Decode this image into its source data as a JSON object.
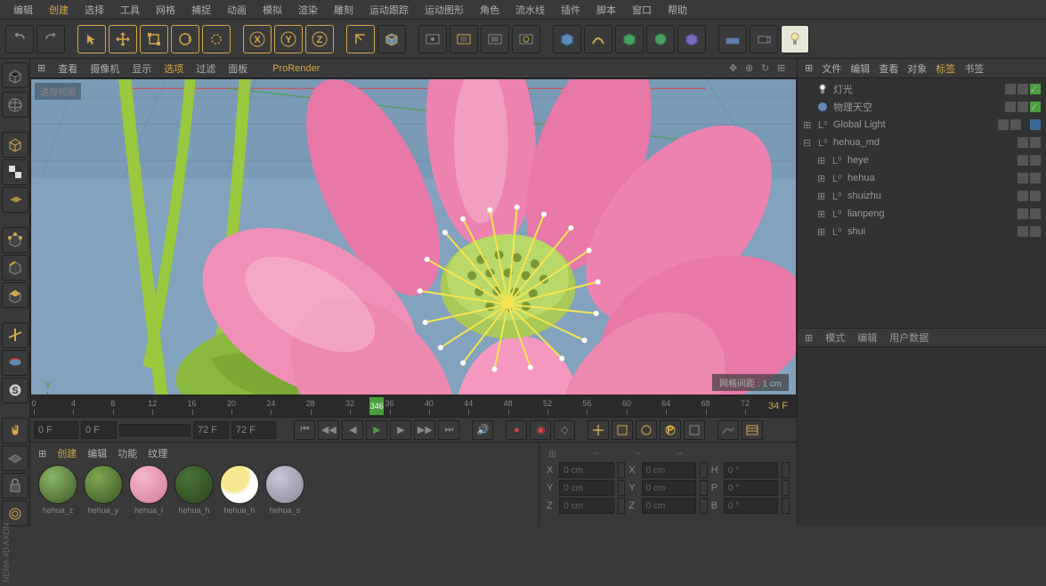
{
  "menubar": [
    "编辑",
    "创建",
    "选择",
    "工具",
    "网格",
    "捕捉",
    "动画",
    "模拟",
    "渲染",
    "雕刻",
    "运动跟踪",
    "运动图形",
    "角色",
    "流水线",
    "插件",
    "脚本",
    "窗口",
    "帮助"
  ],
  "menubar_active": [
    1
  ],
  "viewport_menu": {
    "icon": "⊞",
    "items": [
      "查看",
      "摄像机",
      "显示",
      "选项",
      "过滤",
      "面板"
    ],
    "prorender": "ProRender",
    "active_idx": 3
  },
  "viewport_label": "透视视图",
  "grid_info": "网格间距 : 1 cm",
  "axis": {
    "x": "X",
    "y": "Y",
    "z": "Z"
  },
  "timeline": {
    "ticks": [
      0,
      4,
      8,
      12,
      16,
      20,
      24,
      28,
      32,
      36,
      40,
      44,
      48,
      52,
      56,
      60,
      64,
      68,
      72
    ],
    "playhead": 34,
    "playhead_label": "346",
    "frame_display": "34 F"
  },
  "playback": {
    "start": "0 F",
    "slider_end": "0 F",
    "end": "72 F",
    "end2": "72 F"
  },
  "materials_menu": {
    "items": [
      "创建",
      "编辑",
      "功能",
      "纹理"
    ],
    "active_idx": 0
  },
  "materials": [
    {
      "name": "hehua_z",
      "color": "radial-gradient(circle at 35% 30%, #8ab665, #3d5828)"
    },
    {
      "name": "hehua_y",
      "color": "radial-gradient(circle at 35% 30%, #7ea852, #3a5524)"
    },
    {
      "name": "hehua_l",
      "color": "radial-gradient(circle at 35% 30%, #f5b8cc, #d47a9a)"
    },
    {
      "name": "hehua_h",
      "color": "radial-gradient(circle at 35% 30%, #4a7238, #2a4520)"
    },
    {
      "name": "hehua_h",
      "color": "radial-gradient(circle at 35% 30%, #f5e890 40%, #ffffff 50%)"
    },
    {
      "name": "hehua_s",
      "color": "radial-gradient(circle at 35% 30%, #c8c8d8, #888898)"
    }
  ],
  "coords": {
    "header": [
      "--",
      "--",
      "--"
    ],
    "rows": [
      {
        "axis": "X",
        "pos": "0 cm",
        "scale_axis": "X",
        "scale": "0 cm",
        "rot_axis": "H",
        "rot": "0 °"
      },
      {
        "axis": "Y",
        "pos": "0 cm",
        "scale_axis": "Y",
        "scale": "0 cm",
        "rot_axis": "P",
        "rot": "0 °"
      },
      {
        "axis": "Z",
        "pos": "0 cm",
        "scale_axis": "Z",
        "scale": "0 cm",
        "rot_axis": "B",
        "rot": "0 °"
      }
    ]
  },
  "obj_tabs": {
    "items": [
      "文件",
      "编辑",
      "查看",
      "对象",
      "标签",
      "书签"
    ],
    "active_idx": 4
  },
  "obj_tree": [
    {
      "indent": 0,
      "expand": "",
      "icon": "light",
      "label": "灯光",
      "green": true
    },
    {
      "indent": 0,
      "expand": "",
      "icon": "sky",
      "label": "物理天空",
      "green": true
    },
    {
      "indent": 0,
      "expand": "⊞",
      "icon": "null",
      "label": "Global Light",
      "green": false,
      "extra": true
    },
    {
      "indent": 0,
      "expand": "⊟",
      "icon": "null",
      "label": "hehua_md",
      "green": false
    },
    {
      "indent": 1,
      "expand": "⊞",
      "icon": "null",
      "label": "heye",
      "green": false
    },
    {
      "indent": 1,
      "expand": "⊞",
      "icon": "null",
      "label": "hehua",
      "green": false
    },
    {
      "indent": 1,
      "expand": "⊞",
      "icon": "null",
      "label": "shuizhu",
      "green": false
    },
    {
      "indent": 1,
      "expand": "⊞",
      "icon": "null",
      "label": "lianpeng",
      "green": false
    },
    {
      "indent": 1,
      "expand": "⊞",
      "icon": "null",
      "label": "shui",
      "green": false
    }
  ],
  "attr_header": [
    "模式",
    "编辑",
    "用户数据"
  ],
  "brand": "NEMA 4D  AXON"
}
